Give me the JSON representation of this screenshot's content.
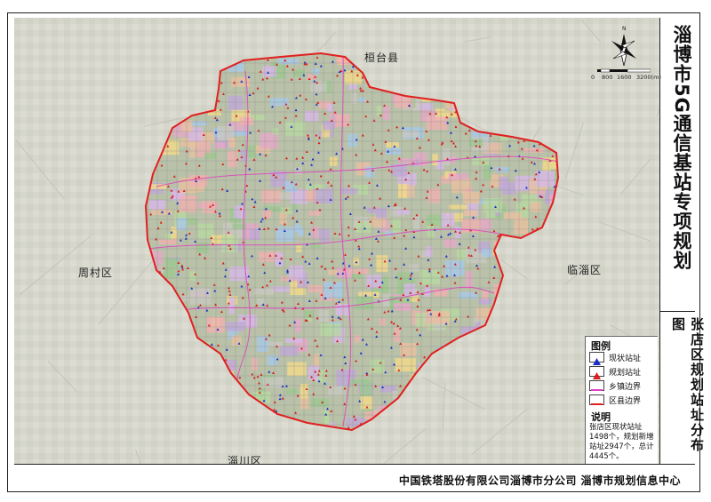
{
  "title": "淄博市5G通信基站专项规划",
  "subtitle": "张店区规划站址分布图",
  "footer": "中国铁塔股份有限公司淄博市分公司   淄博市规划信息中心",
  "districts": {
    "north": "桓台县",
    "west": "周村区",
    "east": "临淄区",
    "south": "淄川区"
  },
  "compass": {
    "north_label": "N"
  },
  "scale": {
    "labels": [
      "0",
      "800",
      "1600",
      "3200(m)"
    ]
  },
  "legend": {
    "title": "图例",
    "items": [
      {
        "label": "现状站址",
        "symbol": "blue-triangle",
        "color": "#1a2ecc"
      },
      {
        "label": "规划站址",
        "symbol": "red-triangle",
        "color": "#d81e1e"
      },
      {
        "label": "乡镇边界",
        "symbol": "pink-line",
        "color": "#e040c0"
      },
      {
        "label": "区县边界",
        "symbol": "red-line",
        "color": "#e02020"
      }
    ]
  },
  "note": {
    "title": "说明",
    "text": "张店区现状站址1498个，规划新增站址2947个，总计4445个。"
  },
  "colors": {
    "existing_site": "#1a2ecc",
    "planned_site": "#d81e1e",
    "town_boundary": "#e040c0",
    "district_boundary": "#e02020",
    "background_imagery": "#d8d8d0"
  }
}
